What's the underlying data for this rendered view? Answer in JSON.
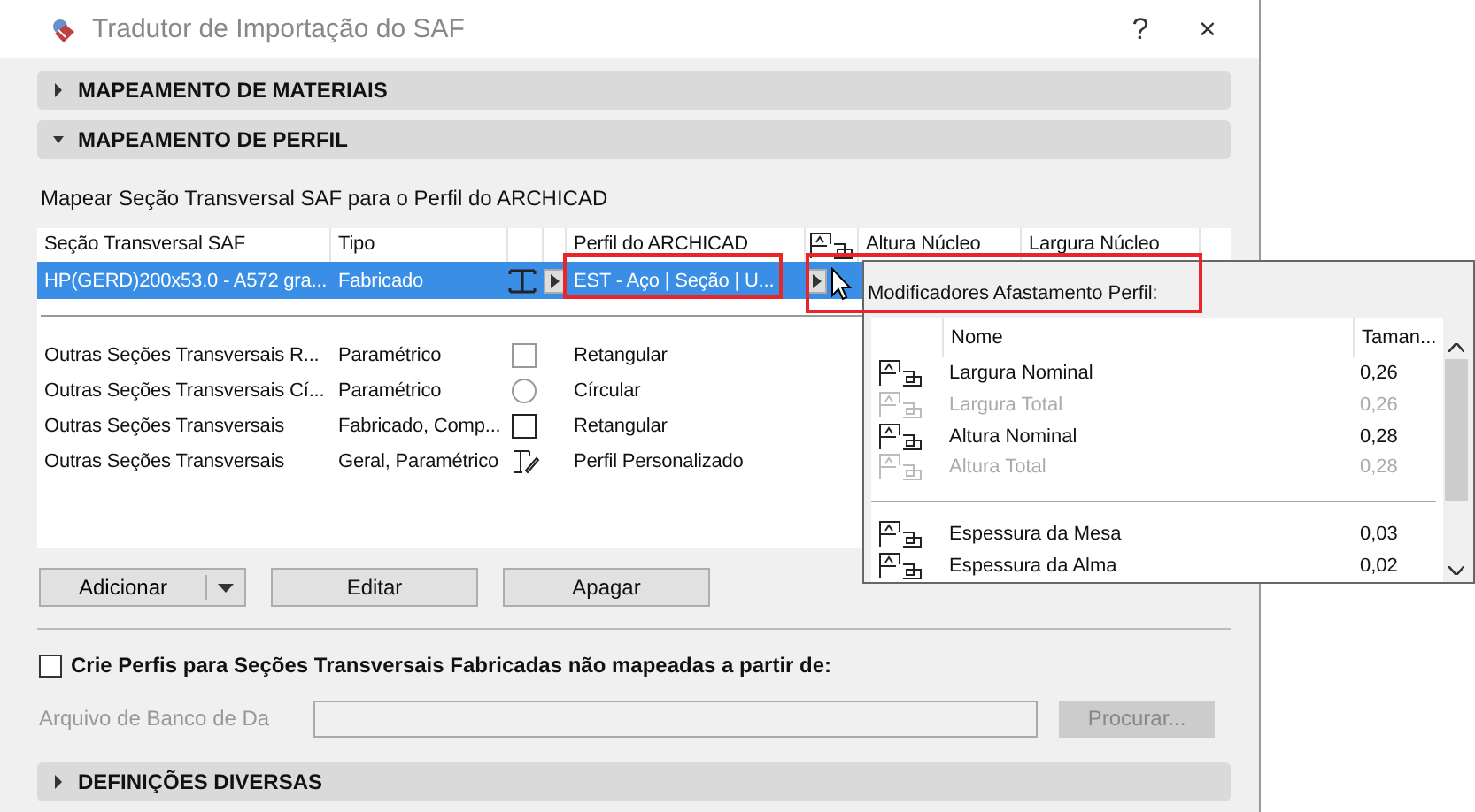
{
  "window": {
    "title": "Tradutor de Importação do SAF",
    "help": "?",
    "close": "×"
  },
  "sections_top": [
    {
      "label": "MAPEAMENTO DE MATERIAIS",
      "expanded": false
    },
    {
      "label": "MAPEAMENTO DE PERFIL",
      "expanded": true
    }
  ],
  "description": "Mapear Seção Transversal SAF para o Perfil do ARCHICAD",
  "table": {
    "columns": [
      "Seção Transversal SAF",
      "Tipo",
      "Perfil do ARCHICAD",
      "Altura Núcleo",
      "Largura Núcleo"
    ],
    "selected_row": {
      "section": "HP(GERD)200x53.0 - A572 gra...",
      "type": "Fabricado",
      "profile": "EST - Aço | Seção | U...",
      "selected": true
    },
    "rows": [
      {
        "section": "Outras Seções Transversais R...",
        "type": "Paramétrico",
        "kind": "rectangle",
        "profile": "Retangular"
      },
      {
        "section": "Outras Seções Transversais Cí...",
        "type": "Paramétrico",
        "kind": "circle",
        "profile": "Círcular"
      },
      {
        "section": "Outras Seções Transversais",
        "type": "Fabricado, Comp...",
        "kind": "box",
        "profile": "Retangular"
      },
      {
        "section": "Outras Seções Transversais",
        "type": "Geral, Paramétrico",
        "kind": "custom",
        "profile": "Perfil Personalizado"
      }
    ]
  },
  "buttons": [
    "Adicionar",
    "Editar",
    "Apagar"
  ],
  "create_profiles": {
    "label": "Crie Perfis para Seções Transversais Fabricadas não mapeadas a partir de:",
    "checked": false
  },
  "database": {
    "label": "Arquivo de Banco de Da",
    "button": "Procurar...",
    "disabled": true
  },
  "sections_bottom": [
    {
      "label": "DEFINIÇÕES DIVERSAS",
      "expanded": false
    }
  ],
  "popup": {
    "title": "Modificadores Afastamento Perfil:",
    "columns": [
      "Nome",
      "Taman..."
    ],
    "groups": [
      [
        {
          "name": "Largura Nominal",
          "value": "0,26",
          "disabled": false
        },
        {
          "name": "Largura Total",
          "value": "0,26",
          "disabled": true
        },
        {
          "name": "Altura Nominal",
          "value": "0,28",
          "disabled": false
        },
        {
          "name": "Altura Total",
          "value": "0,28",
          "disabled": true
        }
      ],
      [
        {
          "name": "Espessura da Mesa",
          "value": "0,03",
          "disabled": false
        },
        {
          "name": "Espessura da Alma",
          "value": "0,02",
          "disabled": false
        }
      ]
    ]
  }
}
